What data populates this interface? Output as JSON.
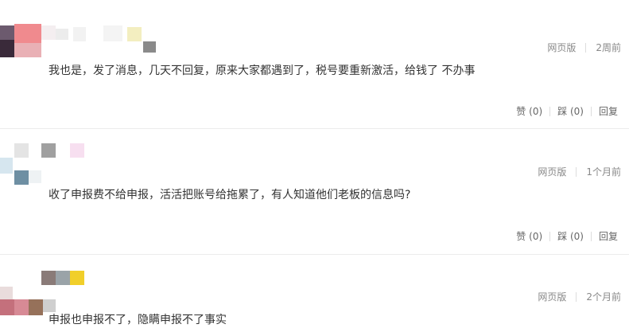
{
  "comments": [
    {
      "platform": "网页版",
      "time": "2周前",
      "text": "我也是，发了消息，几天不回复，原来大家都遇到了，税号要重新激活，给钱了 不办事",
      "like_label": "赞",
      "like_count": "(0)",
      "dislike_label": "踩",
      "dislike_count": "(0)",
      "reply_label": "回复"
    },
    {
      "platform": "网页版",
      "time": "1个月前",
      "text": "收了申报费不给申报，活活把账号给拖累了，有人知道他们老板的信息吗?",
      "like_label": "赞",
      "like_count": "(0)",
      "dislike_label": "踩",
      "dislike_count": "(0)",
      "reply_label": "回复"
    },
    {
      "platform": "网页版",
      "time": "2个月前",
      "text": "申报也申报不了，隐瞒申报不了事实"
    }
  ]
}
